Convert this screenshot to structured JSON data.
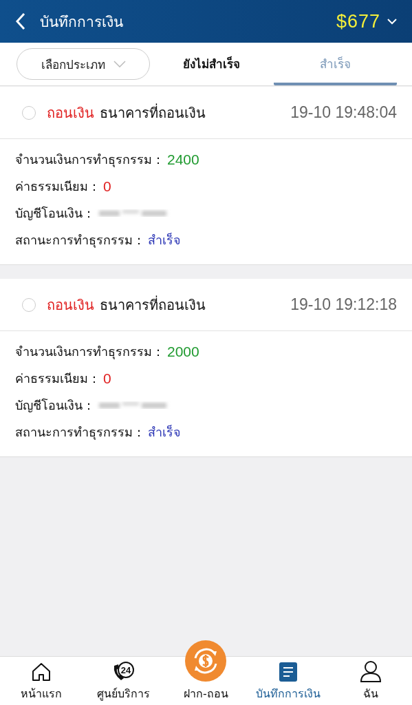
{
  "header": {
    "title": "บันทึกการเงิน",
    "balance": "$677"
  },
  "filter": {
    "label": "เลือกประเภท"
  },
  "tabs": [
    {
      "label": "ยังไม่สำเร็จ",
      "selected": false
    },
    {
      "label": "สำเร็จ",
      "selected": true
    }
  ],
  "records": [
    {
      "selected": false,
      "type": "ถอนเงิน",
      "bank": "ธนาคารที่ถอนเงิน",
      "time": "19-10 19:48:04",
      "fields": [
        {
          "label": "จำนวนเงินการทำธุรกรรม：",
          "value": "2400",
          "kind": "amount"
        },
        {
          "label": "ค่าธรรมเนียม：",
          "value": "0",
          "kind": "fee"
        },
        {
          "label": "บัญชีโอนเงิน：",
          "kind": "redacted"
        },
        {
          "label": "สถานะการทำธุรกรรม：",
          "value": "สำเร็จ",
          "kind": "status"
        }
      ]
    },
    {
      "selected": false,
      "type": "ถอนเงิน",
      "bank": "ธนาคารที่ถอนเงิน",
      "time": "19-10 19:12:18",
      "fields": [
        {
          "label": "จำนวนเงินการทำธุรกรรม：",
          "value": "2000",
          "kind": "amount"
        },
        {
          "label": "ค่าธรรมเนียม：",
          "value": "0",
          "kind": "fee"
        },
        {
          "label": "บัญชีโอนเงิน：",
          "kind": "redacted"
        },
        {
          "label": "สถานะการทำธุรกรรม：",
          "value": "สำเร็จ",
          "kind": "status"
        }
      ]
    }
  ],
  "nav": [
    {
      "kind": "home",
      "label": "หน้าแรก",
      "selected": false
    },
    {
      "kind": "service",
      "label": "ศูนย์บริการ",
      "icon_text": "24",
      "selected": false
    },
    {
      "kind": "deposit",
      "label": "ฝาก-ถอน",
      "selected": false
    },
    {
      "kind": "records",
      "label": "บันทึกการเงิน",
      "selected": true
    },
    {
      "kind": "me",
      "label": "ฉัน",
      "selected": false
    }
  ]
}
